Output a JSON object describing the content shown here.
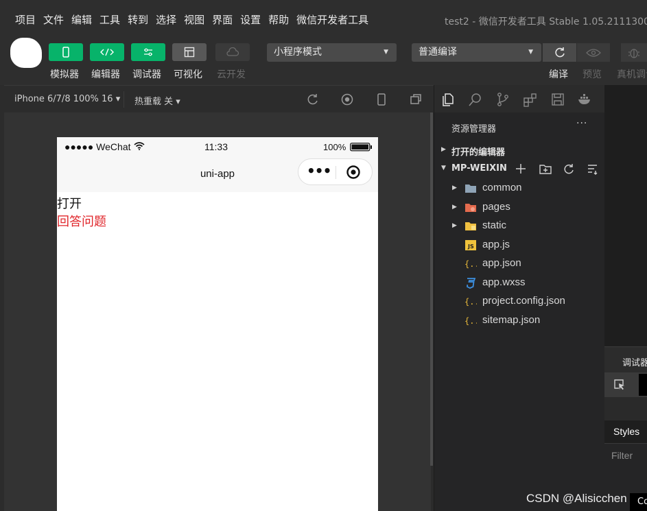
{
  "menu": [
    "项目",
    "文件",
    "编辑",
    "工具",
    "转到",
    "选择",
    "视图",
    "界面",
    "设置",
    "帮助",
    "微信开发者工具"
  ],
  "window_title": "test2 - 微信开发者工具 Stable 1.05.2111300",
  "toolbar": {
    "simulator": "模拟器",
    "editor": "编辑器",
    "debugger": "调试器",
    "visual": "可视化",
    "cloud": "云开发",
    "mode_select": "小程序模式",
    "compile_select": "普通编译",
    "compile_label": "编译",
    "preview_label": "预览",
    "real_debug_label": "真机调试"
  },
  "simbar": {
    "device": "iPhone 6/7/8 100% 16 ▾",
    "hot_reload": "热重载 关 ▾"
  },
  "phone": {
    "signal": "●●●●● WeChat",
    "time": "11:33",
    "battery": "100%",
    "nav_title": "uni-app",
    "capsule_dots": "•••",
    "line_open": "打开",
    "line_answer": "回答问题"
  },
  "explorer": {
    "title": "资源管理器",
    "more": "···",
    "open_editors": "打开的编辑器",
    "project": "MP-WEIXIN",
    "items": [
      {
        "name": "common",
        "type": "folder"
      },
      {
        "name": "pages",
        "type": "folder"
      },
      {
        "name": "static",
        "type": "folder"
      },
      {
        "name": "app.js",
        "type": "js"
      },
      {
        "name": "app.json",
        "type": "json"
      },
      {
        "name": "app.wxss",
        "type": "css"
      },
      {
        "name": "project.config.json",
        "type": "json"
      },
      {
        "name": "sitemap.json",
        "type": "json"
      }
    ]
  },
  "debug": {
    "tab": "调试器",
    "styles": "Styles",
    "filter": "Filter",
    "console_chip": "Co"
  },
  "watermark": "CSDN @Alisicchen",
  "colors": {
    "accent_green": "#07b36a",
    "answer_red": "#e0252a"
  }
}
